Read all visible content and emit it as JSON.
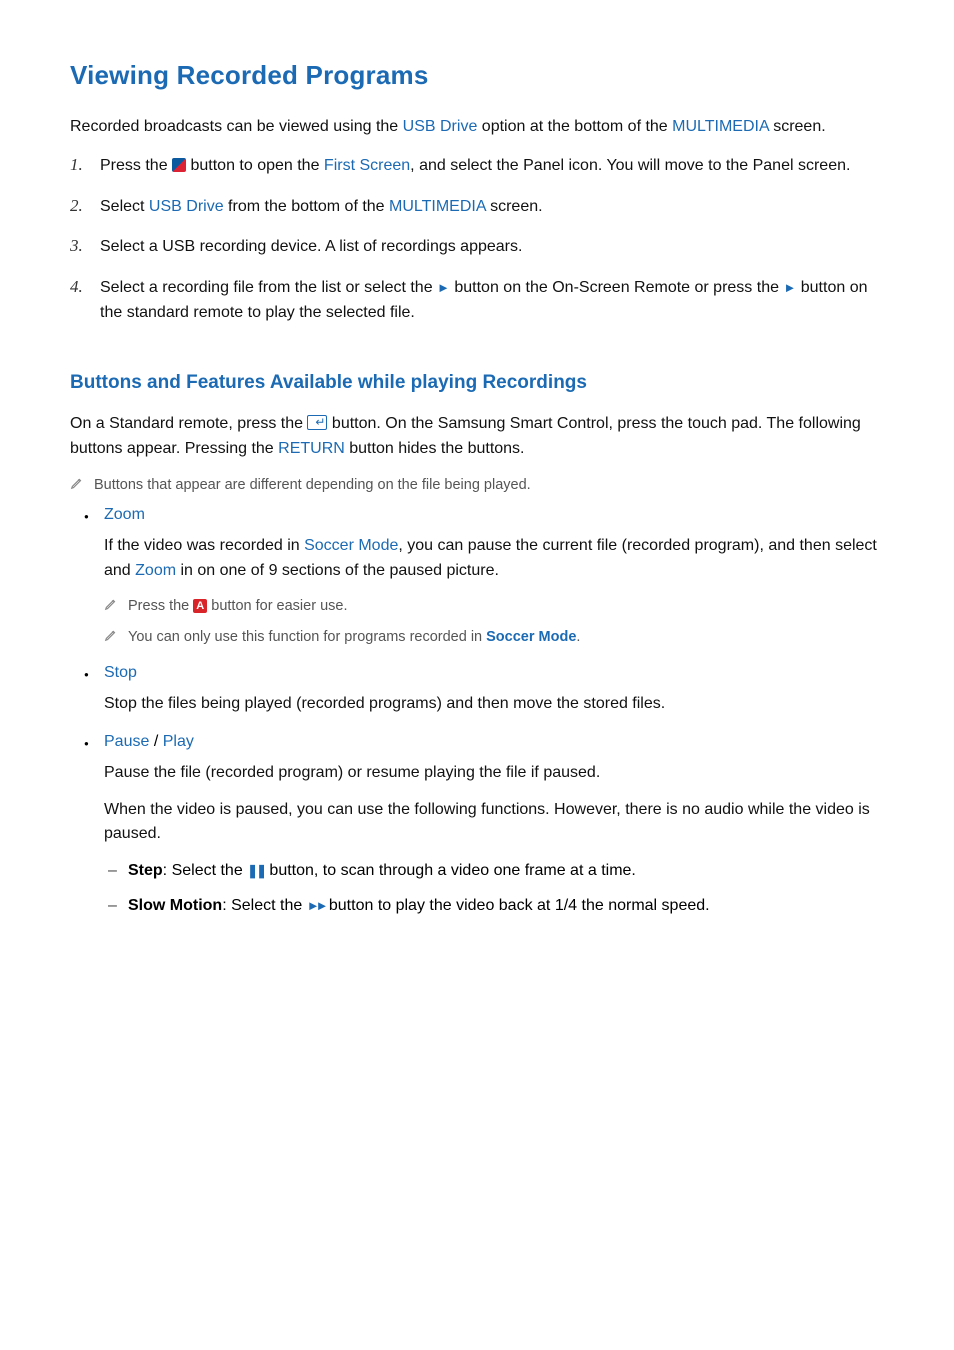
{
  "title": "Viewing Recorded Programs",
  "intro": {
    "t1": "Recorded broadcasts can be viewed using the ",
    "usb": "USB Drive",
    "t2": " option at the bottom of the ",
    "mm": "MULTIMEDIA",
    "t3": " screen."
  },
  "steps": {
    "n1": "1.",
    "s1a": "Press the ",
    "s1b": " button to open the ",
    "s1_first": "First Screen",
    "s1c": ", and select the Panel icon. You will move to the Panel screen.",
    "n2": "2.",
    "s2a": "Select ",
    "s2_usb": "USB Drive",
    "s2b": " from the bottom of the ",
    "s2_mm": "MULTIMEDIA",
    "s2c": " screen.",
    "n3": "3.",
    "s3": "Select a USB recording device. A list of recordings appears.",
    "n4": "4.",
    "s4a": "Select a recording file from the list or select the ",
    "s4b": " button on the On-Screen Remote or press the ",
    "s4c": " button on the standard remote to play the selected file."
  },
  "h2": "Buttons and Features Available while playing Recordings",
  "p2a": "On a Standard remote, press the ",
  "p2b": " button. On the Samsung Smart Control, press the touch pad. The following buttons appear. Pressing the ",
  "p2_return": "RETURN",
  "p2c": " button hides the buttons.",
  "note_top": "Buttons that appear are different depending on the file being played.",
  "zoom": {
    "title": "Zoom",
    "body_a": "If the video was recorded in ",
    "soccer": "Soccer Mode",
    "body_b": ", you can pause the current file (recorded program), and then select and ",
    "zoom_word": "Zoom",
    "body_c": " in on one of 9 sections of the paused picture.",
    "note1_a": "Press the ",
    "note1_b": " button for easier use.",
    "a_label": "A",
    "note2_a": "You can only use this function for programs recorded in ",
    "note2_b": "."
  },
  "stop": {
    "title": "Stop",
    "body": "Stop the files being played (recorded programs) and then move the stored files."
  },
  "pauseplay": {
    "title_pause": "Pause",
    "title_sep": " / ",
    "title_play": "Play",
    "body1": "Pause the file (recorded program) or resume playing the file if paused.",
    "body2": "When the video is paused, you can use the following functions. However, there is no audio while the video is paused.",
    "step_label": "Step",
    "step_a": ": Select the ",
    "step_b": " button, to scan through a video one frame at a time.",
    "slow_label": "Slow Motion",
    "slow_a": ": Select the ",
    "slow_b": " button to play the video back at 1/4 the normal speed."
  },
  "icons": {
    "play": "►",
    "pause": "❚❚",
    "ff": "►►"
  }
}
